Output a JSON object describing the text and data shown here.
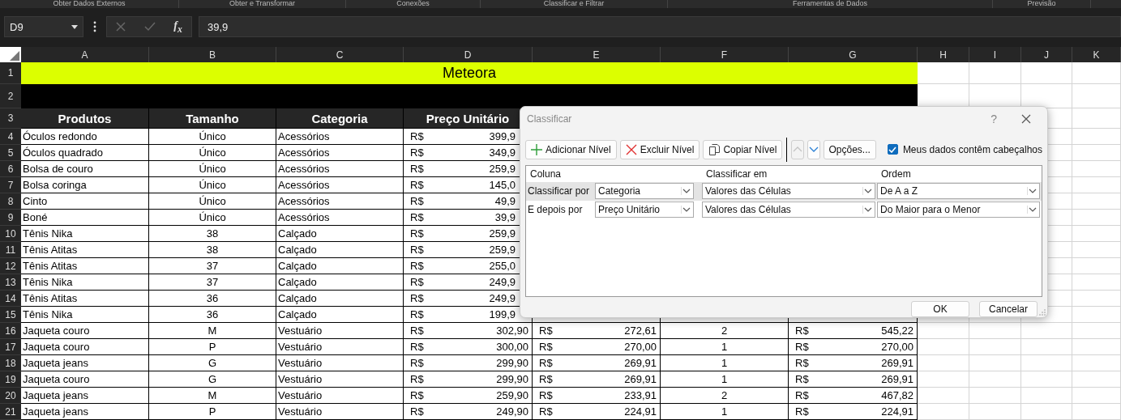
{
  "ribbon_groups": [
    "Obter Dados Externos",
    "Obter e Transformar",
    "Conexões",
    "Classificar e Filtrar",
    "Ferramentas de Dados",
    "Previsão"
  ],
  "formula_bar": {
    "name_box": "D9",
    "function_label": "f$_{x}$",
    "value": "39,9"
  },
  "columns": [
    "A",
    "B",
    "C",
    "D",
    "E",
    "F",
    "G",
    "H",
    "I",
    "J",
    "K"
  ],
  "title_row": {
    "row": "1",
    "text": "Meteora"
  },
  "blank_row": {
    "row": "2"
  },
  "header_row": {
    "row": "3",
    "cells": [
      "Produtos",
      "Tamanho",
      "Categoria",
      "Preço Unitário"
    ]
  },
  "rows": [
    {
      "row": "4",
      "product": "Óculos redondo",
      "size": "Único",
      "category": "Acessórios",
      "price_currency": "R$",
      "price": "399,9"
    },
    {
      "row": "5",
      "product": "Óculos quadrado",
      "size": "Único",
      "category": "Acessórios",
      "price_currency": "R$",
      "price": "349,9"
    },
    {
      "row": "6",
      "product": "Bolsa de couro",
      "size": "Único",
      "category": "Acessórios",
      "price_currency": "R$",
      "price": "259,9"
    },
    {
      "row": "7",
      "product": "Bolsa coringa",
      "size": "Único",
      "category": "Acessórios",
      "price_currency": "R$",
      "price": "145,0"
    },
    {
      "row": "8",
      "product": "Cinto",
      "size": "Único",
      "category": "Acessórios",
      "price_currency": "R$",
      "price": "49,9"
    },
    {
      "row": "9",
      "product": "Boné",
      "size": "Único",
      "category": "Acessórios",
      "price_currency": "R$",
      "price": "39,9"
    },
    {
      "row": "10",
      "product": "Tênis Nika",
      "size": "38",
      "category": "Calçado",
      "price_currency": "R$",
      "price": "259,9"
    },
    {
      "row": "11",
      "product": "Tênis Atitas",
      "size": "38",
      "category": "Calçado",
      "price_currency": "R$",
      "price": "259,9"
    },
    {
      "row": "12",
      "product": "Tênis Atitas",
      "size": "37",
      "category": "Calçado",
      "price_currency": "R$",
      "price": "255,0"
    },
    {
      "row": "13",
      "product": "Tênis Nika",
      "size": "37",
      "category": "Calçado",
      "price_currency": "R$",
      "price": "249,9"
    },
    {
      "row": "14",
      "product": "Tênis Atitas",
      "size": "36",
      "category": "Calçado",
      "price_currency": "R$",
      "price": "249,9"
    },
    {
      "row": "15",
      "product": "Tênis Nika",
      "size": "36",
      "category": "Calçado",
      "price_currency": "R$",
      "price": "199,9"
    },
    {
      "row": "16",
      "product": "Jaqueta couro",
      "size": "M",
      "category": "Vestuário",
      "price_currency": "R$",
      "price": "302,90",
      "column_e_currency": "R$",
      "column_e": "272,61",
      "column_f": "2",
      "column_g_currency": "R$",
      "column_g": "545,22"
    },
    {
      "row": "17",
      "product": "Jaqueta couro",
      "size": "P",
      "category": "Vestuário",
      "price_currency": "R$",
      "price": "300,00",
      "column_e_currency": "R$",
      "column_e": "270,00",
      "column_f": "1",
      "column_g_currency": "R$",
      "column_g": "270,00"
    },
    {
      "row": "18",
      "product": "Jaqueta jeans",
      "size": "G",
      "category": "Vestuário",
      "price_currency": "R$",
      "price": "299,90",
      "column_e_currency": "R$",
      "column_e": "269,91",
      "column_f": "1",
      "column_g_currency": "R$",
      "column_g": "269,91"
    },
    {
      "row": "19",
      "product": "Jaqueta couro",
      "size": "G",
      "category": "Vestuário",
      "price_currency": "R$",
      "price": "299,90",
      "column_e_currency": "R$",
      "column_e": "269,91",
      "column_f": "1",
      "column_g_currency": "R$",
      "column_g": "269,91"
    },
    {
      "row": "20",
      "product": "Jaqueta jeans",
      "size": "M",
      "category": "Vestuário",
      "price_currency": "R$",
      "price": "259,90",
      "column_e_currency": "R$",
      "column_e": "233,91",
      "column_f": "2",
      "column_g_currency": "R$",
      "column_g": "467,82"
    },
    {
      "row": "21",
      "product": "Jaqueta jeans",
      "size": "P",
      "category": "Vestuário",
      "price_currency": "R$",
      "price": "249,90",
      "column_e_currency": "R$",
      "column_e": "224,91",
      "column_f": "1",
      "column_g_currency": "R$",
      "column_g": "224,91"
    }
  ],
  "dialog": {
    "title": "Classificar",
    "help": "?",
    "toolbar": [
      {
        "kind": "add",
        "label": "Adicionar Nível"
      },
      {
        "kind": "delete",
        "label": "Excluir Nível"
      },
      {
        "kind": "copy",
        "label": "Copiar Nível"
      },
      {
        "kind": "up",
        "disabled": true
      },
      {
        "kind": "down",
        "disabled": false
      },
      {
        "kind": "options",
        "label": "Opções..."
      }
    ],
    "headers_checkbox": {
      "label": "Meus dados contêm cabeçalhos",
      "checked": true
    },
    "list_headers": [
      "Coluna",
      "Classificar em",
      "Ordem"
    ],
    "levels": [
      {
        "label": "Classificar por",
        "selected": true,
        "column": "Categoria",
        "sort_on": "Valores das Células",
        "order": "De A a Z"
      },
      {
        "label": "E depois por",
        "selected": false,
        "column": "Preço Unitário",
        "sort_on": "Valores das Células",
        "order": "Do Maior para o Menor"
      }
    ],
    "buttons": [
      "OK",
      "Cancelar"
    ]
  }
}
